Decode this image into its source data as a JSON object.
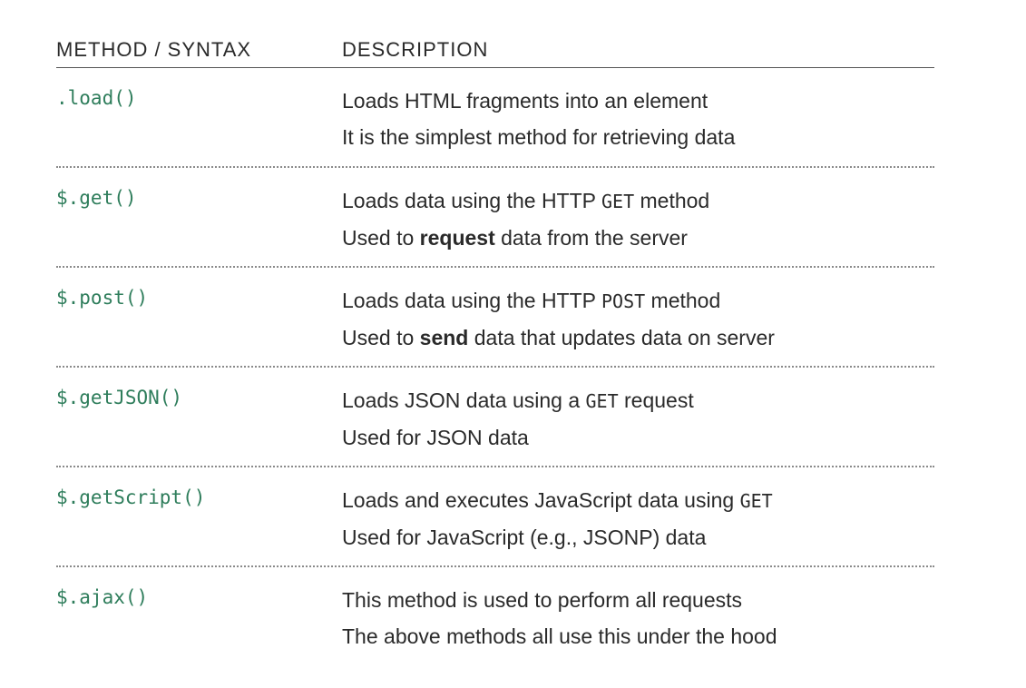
{
  "header": {
    "method_label": "METHOD / SYNTAX",
    "description_label": "DESCRIPTION"
  },
  "rows": [
    {
      "method": ".load()",
      "line1": "Loads HTML fragments into an element",
      "line2": "It is the simplest method for retrieving data"
    },
    {
      "method": "$.get()",
      "line1_pre": "Loads data using the HTTP ",
      "line1_code": "GET",
      "line1_post": " method",
      "line2_pre": "Used to ",
      "line2_bold": "request",
      "line2_post": " data from the server"
    },
    {
      "method": "$.post()",
      "line1_pre": "Loads data using the HTTP ",
      "line1_code": "POST",
      "line1_post": " method",
      "line2_pre": "Used to ",
      "line2_bold": "send",
      "line2_post": " data that updates data on server"
    },
    {
      "method": "$.getJSON()",
      "line1_pre": "Loads JSON data using a ",
      "line1_code": "GET",
      "line1_post": " request",
      "line2": "Used for JSON data"
    },
    {
      "method": "$.getScript()",
      "line1_pre": "Loads and executes JavaScript data using ",
      "line1_code": "GET",
      "line2": "Used for JavaScript (e.g., JSONP) data"
    },
    {
      "method": "$.ajax()",
      "line1": "This method is used to perform all requests",
      "line2": "The above methods all use this under the hood"
    }
  ],
  "colors": {
    "method_text": "#2e7d5b",
    "body_text": "#2a2a2a"
  }
}
